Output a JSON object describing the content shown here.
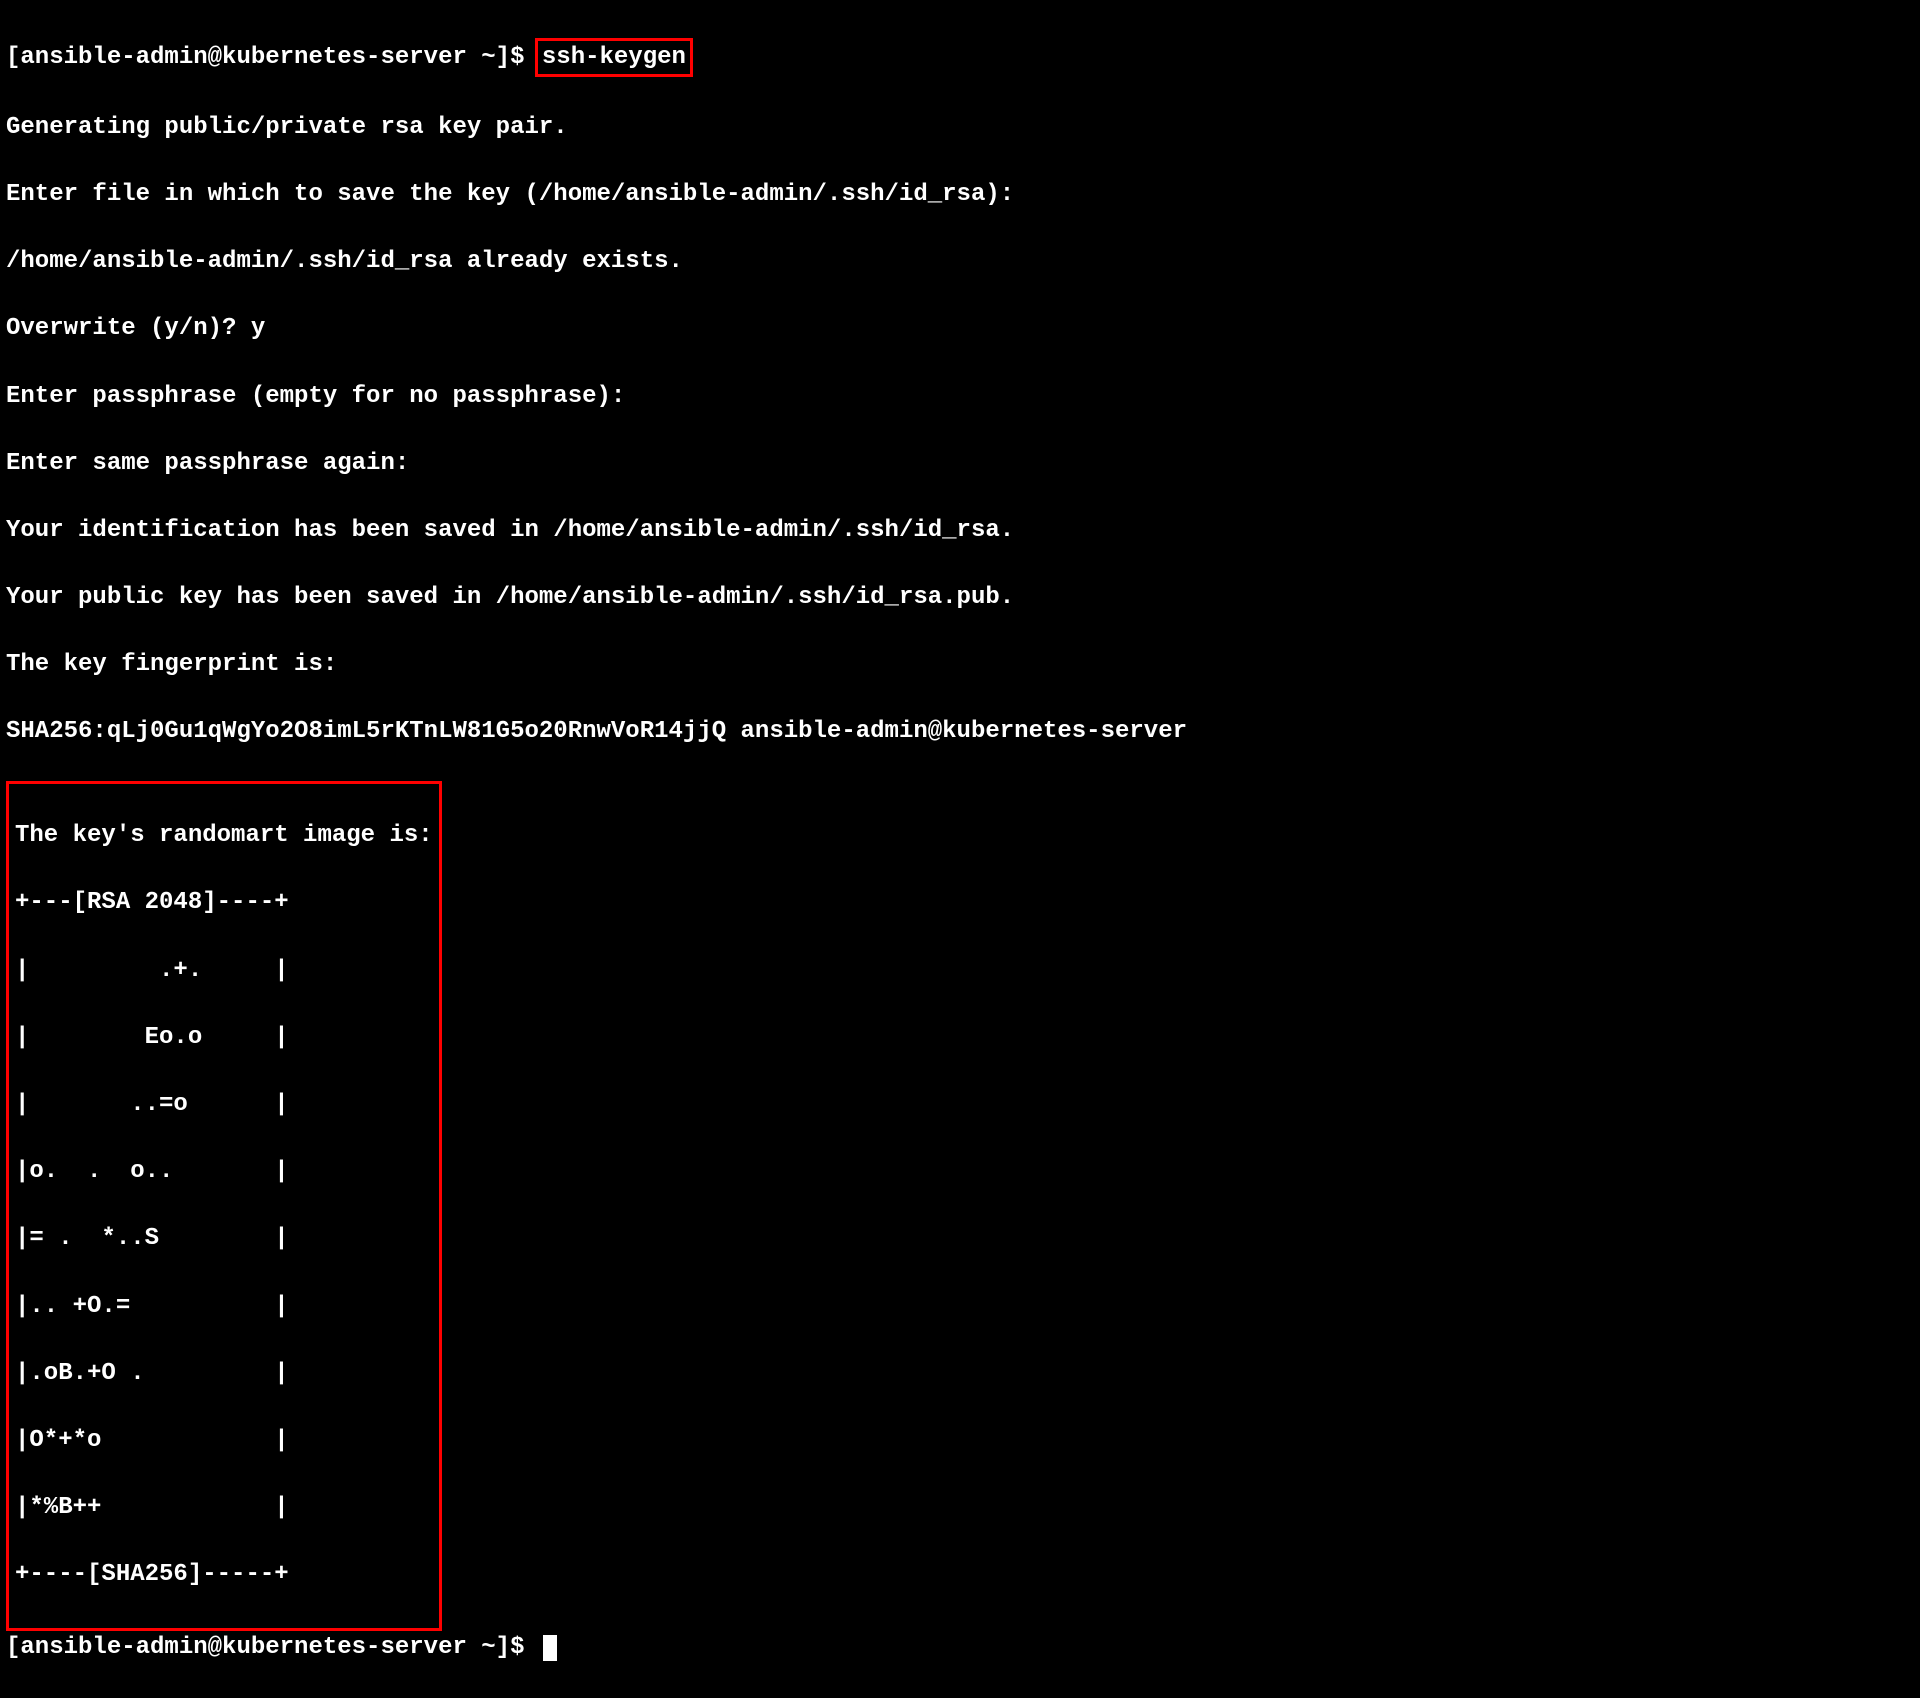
{
  "prompt1_prefix": "[ansible-admin@kubernetes-server ~]$ ",
  "command": "ssh-keygen",
  "line_generating": "Generating public/private rsa key pair.",
  "line_enter_file": "Enter file in which to save the key (/home/ansible-admin/.ssh/id_rsa):",
  "line_already_exists": "/home/ansible-admin/.ssh/id_rsa already exists.",
  "line_overwrite": "Overwrite (y/n)? y",
  "line_passphrase": "Enter passphrase (empty for no passphrase):",
  "line_passphrase_again": "Enter same passphrase again:",
  "line_id_saved": "Your identification has been saved in /home/ansible-admin/.ssh/id_rsa.",
  "line_pub_saved": "Your public key has been saved in /home/ansible-admin/.ssh/id_rsa.pub.",
  "line_fingerprint": "The key fingerprint is:",
  "line_sha": "SHA256:qLj0Gu1qWgYo2O8imL5rKTnLW81G5o20RnwVoR14jjQ ansible-admin@kubernetes-server",
  "randomart": {
    "title": "The key's randomart image is:",
    "top": "+---[RSA 2048]----+",
    "r1": "|         .+.     |",
    "r2": "|        Eo.o     |",
    "r3": "|       ..=o      |",
    "r4": "|o.  .  o..       |",
    "r5": "|= .  *..S        |",
    "r6": "|.. +O.=          |",
    "r7": "|.oB.+O .         |",
    "r8": "|O*+*o            |",
    "r9": "|*%B++            |",
    "bottom": "+----[SHA256]-----+"
  },
  "prompt2": "[ansible-admin@kubernetes-server ~]$ "
}
